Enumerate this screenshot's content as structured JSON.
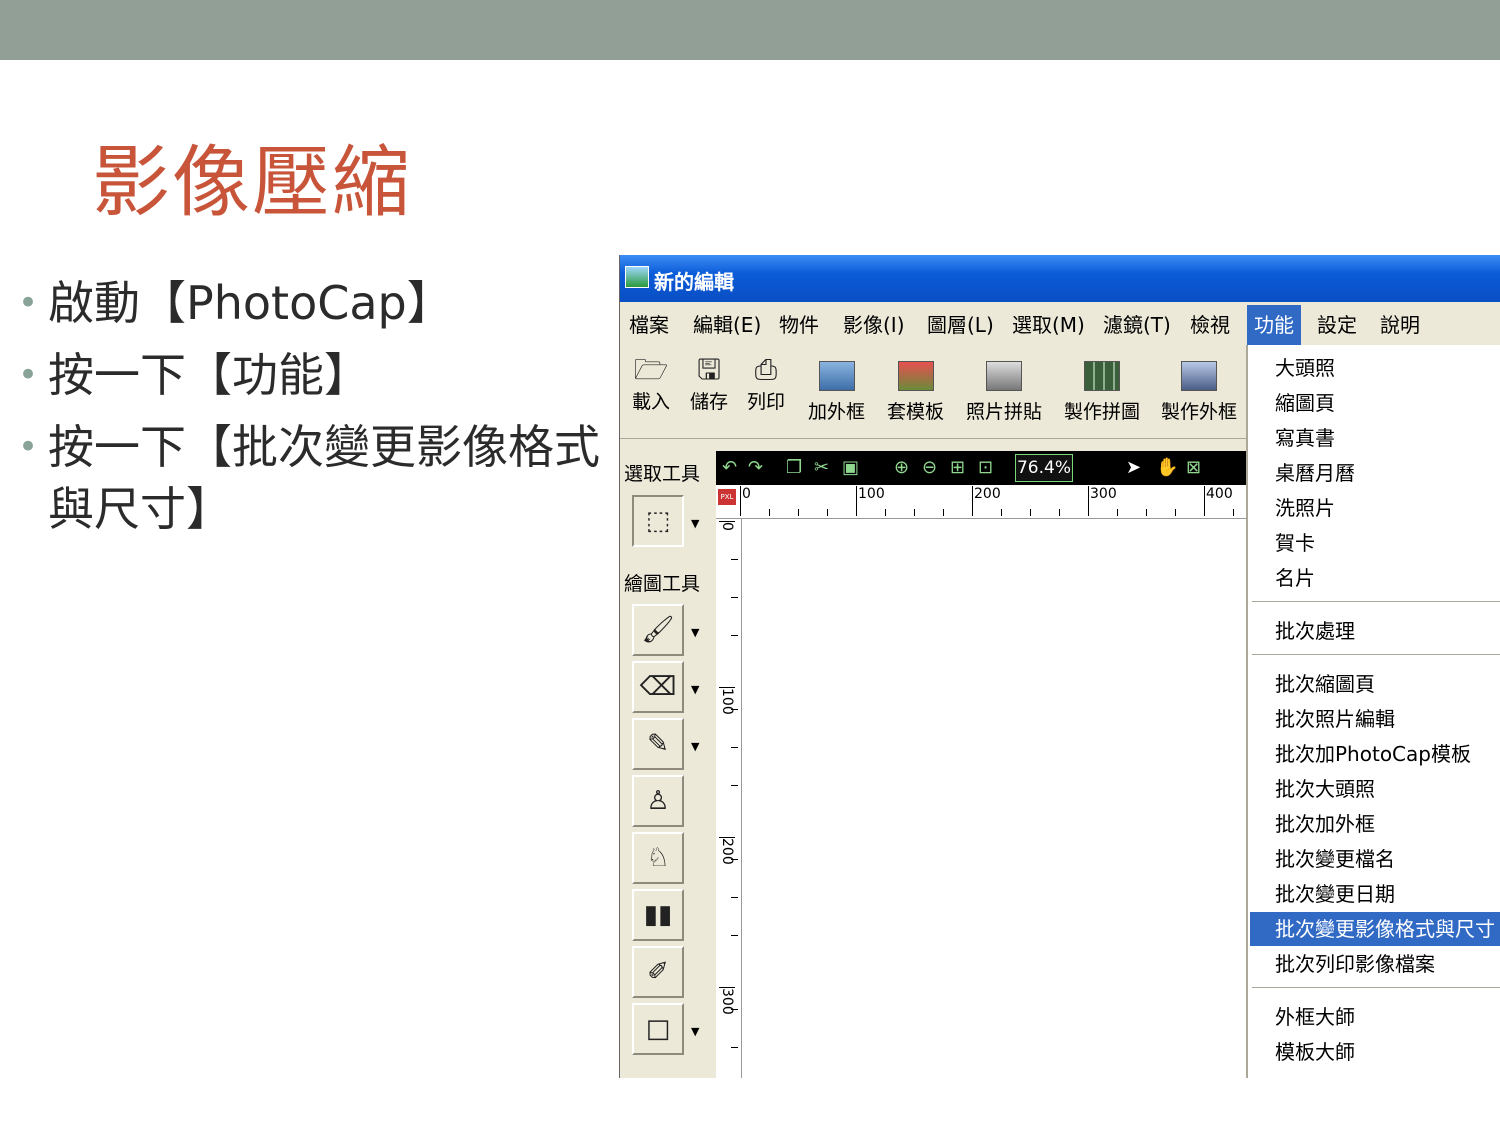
{
  "slide": {
    "title": "影像壓縮",
    "bullets": [
      "啟動【PhotoCap】",
      "按一下【功能】",
      "按一下【批次變更影像格式與尺寸】"
    ]
  },
  "window": {
    "title": "新的編輯",
    "menus": [
      "檔案",
      "編輯(E)",
      "物件",
      "影像(I)",
      "圖層(L)",
      "選取(M)",
      "濾鏡(T)",
      "檢視",
      "功能",
      "設定",
      "說明"
    ],
    "active_menu": "功能",
    "toolbar": [
      {
        "label": "載入",
        "icon": "open-folder-icon"
      },
      {
        "label": "儲存",
        "icon": "floppy-icon"
      },
      {
        "label": "列印",
        "icon": "printer-icon"
      },
      {
        "label": "加外框",
        "icon": "frame-icon"
      },
      {
        "label": "套模板",
        "icon": "template-icon"
      },
      {
        "label": "照片拼貼",
        "icon": "collage-icon"
      },
      {
        "label": "製作拼圖",
        "icon": "puzzle-icon"
      },
      {
        "label": "製作外框",
        "icon": "make-frame-icon"
      }
    ],
    "select_tools_label": "選取工具",
    "draw_tools_label": "繪圖工具",
    "zoom": "76.4%",
    "ruler_badge": "PXL",
    "ruler_top_labels": [
      "0",
      "100",
      "200",
      "300",
      "400"
    ],
    "ruler_left_labels": [
      "0",
      "100",
      "200",
      "300"
    ],
    "function_menu": [
      {
        "label": "大頭照"
      },
      {
        "label": "縮圖頁"
      },
      {
        "label": "寫真書"
      },
      {
        "label": "桌曆月曆"
      },
      {
        "label": "洗照片"
      },
      {
        "label": "賀卡"
      },
      {
        "label": "名片"
      },
      {
        "separator": true
      },
      {
        "label": "批次處理"
      },
      {
        "separator": true
      },
      {
        "label": "批次縮圖頁"
      },
      {
        "label": "批次照片編輯"
      },
      {
        "label": "批次加PhotoCap模板"
      },
      {
        "label": "批次大頭照"
      },
      {
        "label": "批次加外框"
      },
      {
        "label": "批次變更檔名"
      },
      {
        "label": "批次變更日期"
      },
      {
        "label": "批次變更影像格式與尺寸",
        "selected": true
      },
      {
        "label": "批次列印影像檔案"
      },
      {
        "separator": true
      },
      {
        "label": "外框大師"
      },
      {
        "label": "模板大師"
      }
    ]
  }
}
